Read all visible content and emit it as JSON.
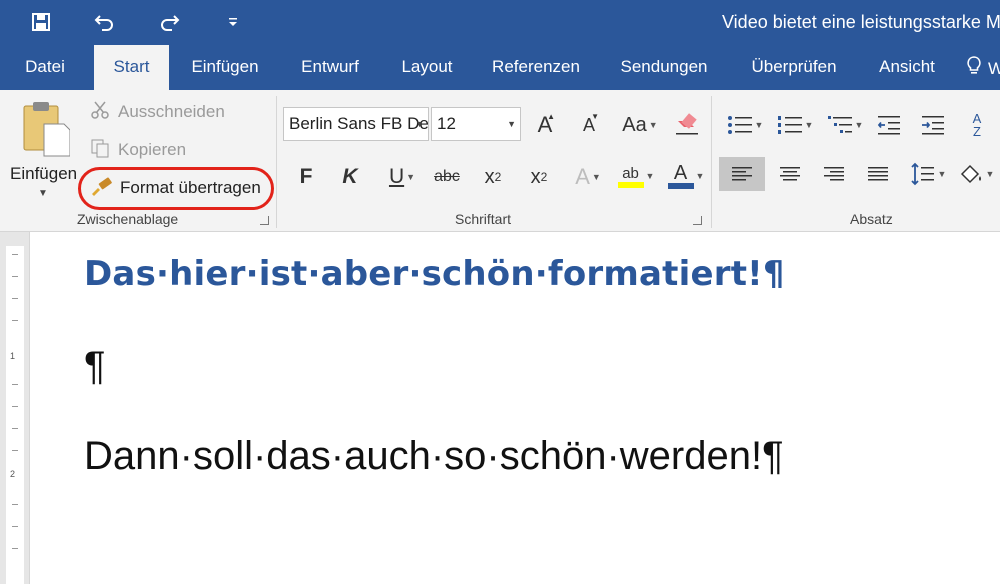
{
  "window": {
    "title": "Video bietet eine leistungsstarke Mög"
  },
  "tabs": [
    {
      "label": "Datei"
    },
    {
      "label": "Start"
    },
    {
      "label": "Einfügen"
    },
    {
      "label": "Entwurf"
    },
    {
      "label": "Layout"
    },
    {
      "label": "Referenzen"
    },
    {
      "label": "Sendungen"
    },
    {
      "label": "Überprüfen"
    },
    {
      "label": "Ansicht"
    }
  ],
  "tellme": {
    "label": "W"
  },
  "clipboard": {
    "group_label": "Zwischenablage",
    "paste_label": "Einfügen",
    "cut_label": "Ausschneiden",
    "copy_label": "Kopieren",
    "format_painter_label": "Format übertragen"
  },
  "font": {
    "group_label": "Schriftart",
    "font_name": "Berlin Sans FB De",
    "font_size": "12",
    "bold": "F",
    "italic": "K",
    "underline": "U",
    "strike": "abc",
    "sub": "x",
    "sub_2": "2",
    "sup": "x",
    "sup_2": "2",
    "grow": "A",
    "shrink": "A",
    "case": "Aa",
    "effects": "A",
    "highlight": "ab",
    "color": "A"
  },
  "paragraph": {
    "group_label": "Absatz",
    "sort": "A",
    "sort_z": "Z"
  },
  "colors": {
    "accent": "#2b579a",
    "ribbon_bg": "#f3f3f3",
    "highlight_ring": "#e2231a",
    "highlighter_yellow": "#ffff00",
    "font_color_bar": "#2b579a"
  },
  "icons": {
    "save": "save-icon",
    "undo": "undo-icon",
    "redo": "redo-icon",
    "customize": "chevron-down-icon",
    "lightbulb": "lightbulb-icon"
  },
  "ruler": {
    "marks": [
      "1",
      "2"
    ]
  },
  "document": {
    "heading": "Das·hier·ist·aber·schön·formatiert!¶",
    "empty_paragraph": "¶",
    "body": "Dann·soll·das·auch·so·schön·werden!¶"
  }
}
